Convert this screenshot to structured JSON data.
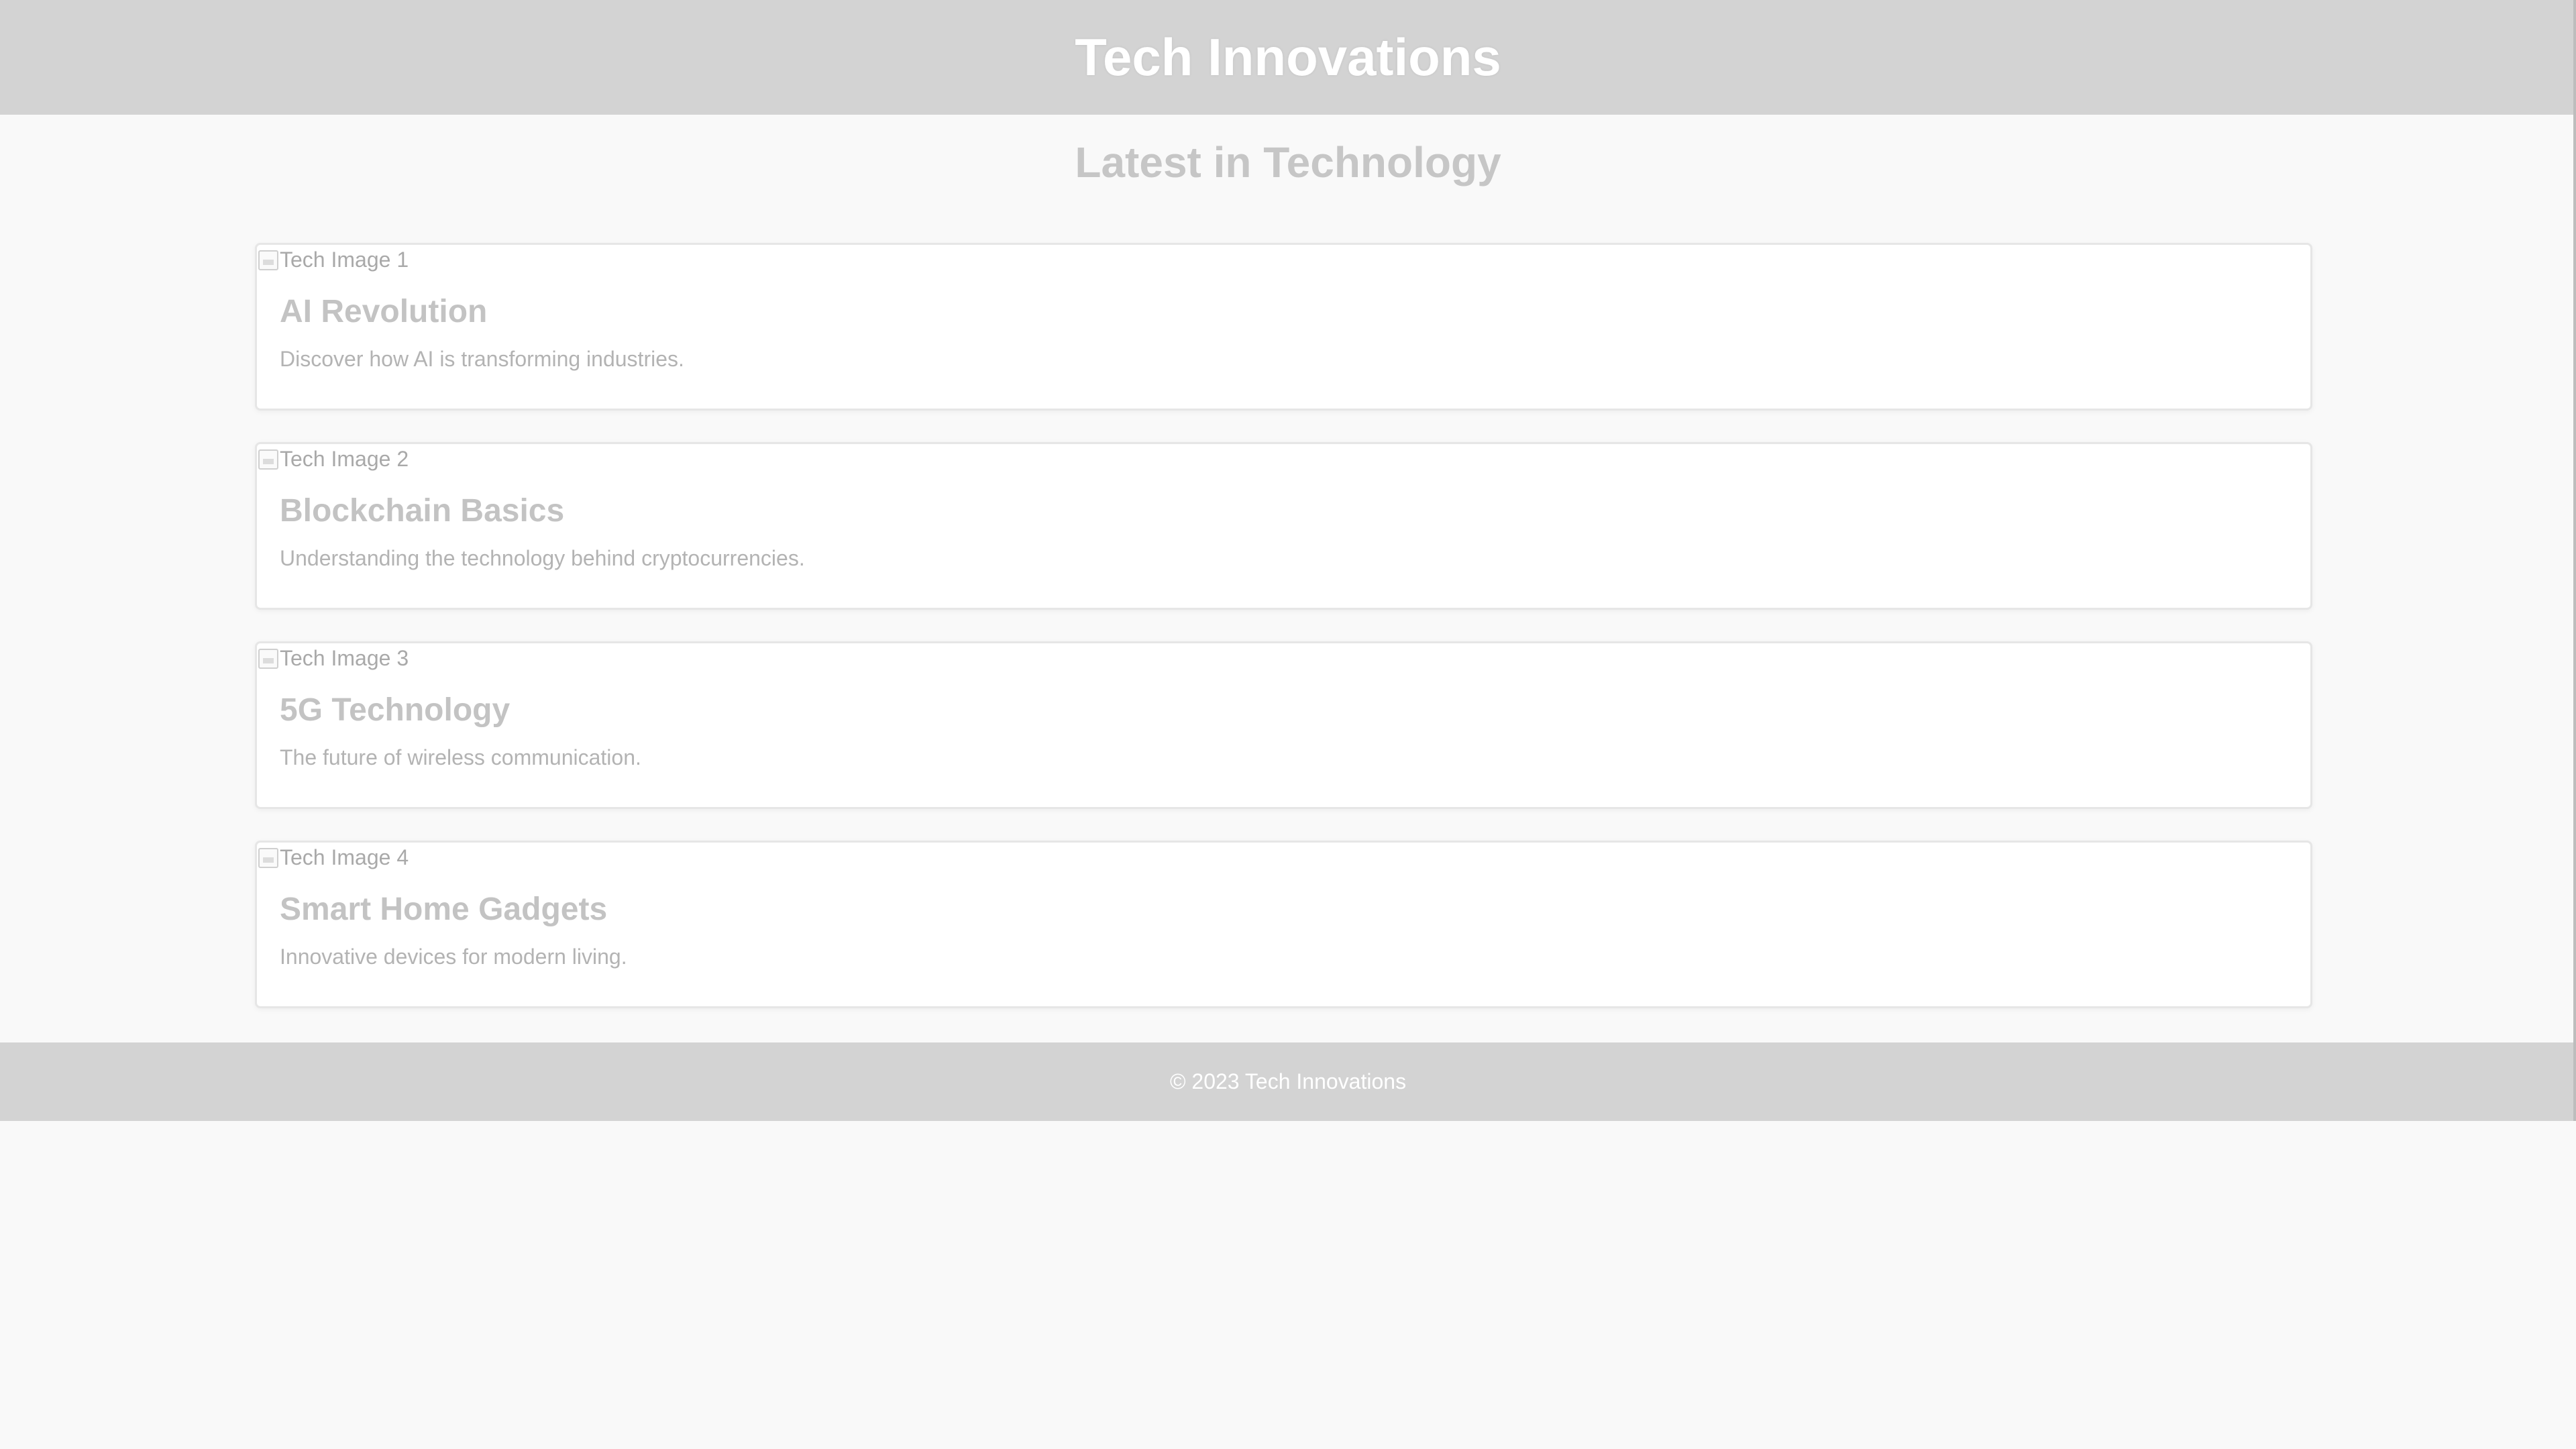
{
  "header": {
    "title": "Tech Innovations"
  },
  "main": {
    "heading": "Latest in Technology",
    "cards": [
      {
        "image_alt": "Tech Image 1",
        "title": "AI Revolution",
        "description": "Discover how AI is transforming industries."
      },
      {
        "image_alt": "Tech Image 2",
        "title": "Blockchain Basics",
        "description": "Understanding the technology behind cryptocurrencies."
      },
      {
        "image_alt": "Tech Image 3",
        "title": "5G Technology",
        "description": "The future of wireless communication."
      },
      {
        "image_alt": "Tech Image 4",
        "title": "Smart Home Gadgets",
        "description": "Innovative devices for modern living."
      }
    ]
  },
  "footer": {
    "text": "© 2023 Tech Innovations"
  },
  "colors": {
    "header_bg": "#d3d3d3",
    "page_bg": "#f9f9f9",
    "card_bg": "#ffffff"
  },
  "icons": {
    "image_placeholder": "broken-image-icon"
  }
}
